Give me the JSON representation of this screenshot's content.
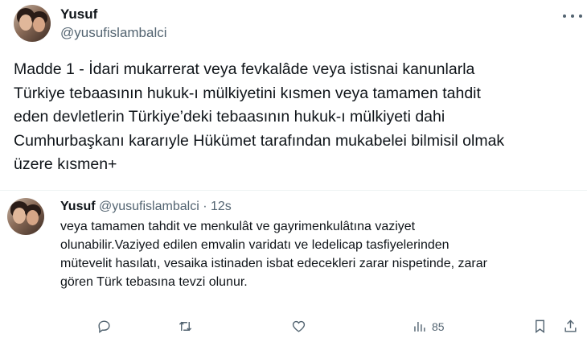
{
  "main_tweet": {
    "name": "Yusuf",
    "handle": "@yusufislambalci",
    "text": "Madde 1 - İdari mukarrerat veya fevkalâde veya istisnai kanunlarla\nTürkiye tebaasının hukuk-ı mülkiyetini kısmen veya tamamen tahdit\neden devletlerin Türkiye’deki tebaasının hukuk-ı mülkiyeti dahi\nCumhurbaşkanı kararıyle Hükümet tarafından mukabelei bilmisil olmak\nüzere kısmen+"
  },
  "reply_tweet": {
    "name": "Yusuf",
    "handle": "@yusufislambalci",
    "separator": "·",
    "time": "12s",
    "text": "veya tamamen tahdit ve menkulât ve gayrimenkulâtına vaziyet\nolunabilir.Vaziyed edilen emvalin varidatı ve ledelicap tasfiyelerinden\nmütevelit hasılatı, vesaika istinaden isbat edecekleri zarar nispetinde, zarar\ngören Türk tebasına tevzi olunur."
  },
  "actions": {
    "views_count": "85"
  },
  "icons": {
    "more": "more-horizontal-icon",
    "reply": "reply-icon",
    "retweet": "retweet-icon",
    "like": "heart-icon",
    "views": "views-icon",
    "bookmark": "bookmark-icon",
    "share": "share-icon"
  },
  "colors": {
    "text_primary": "#0f1419",
    "text_secondary": "#536471",
    "divider": "#eff3f4"
  }
}
